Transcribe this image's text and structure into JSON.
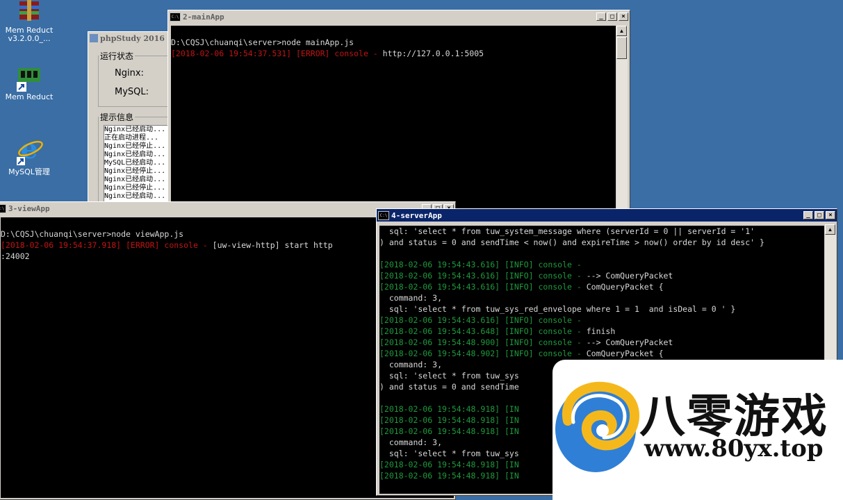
{
  "desktop": {
    "icons": [
      {
        "label": "Mem Reduct\nv3.2.0.0_...",
        "icon": "winrar-archive-icon"
      },
      {
        "label": "Mem Reduct",
        "icon": "memory-chip-icon"
      },
      {
        "label": "MySQL管理",
        "icon": "internet-explorer-icon"
      }
    ]
  },
  "phpstudy": {
    "title": "phpStudy 2016",
    "status_group": "运行状态",
    "nginx_label": "Nginx:",
    "mysql_label": "MySQL:",
    "hint_group": "提示信息",
    "hints": [
      "Nginx已经启动...",
      "正在启动进程...",
      "Nginx已经停止...",
      "Nginx已经启动...",
      "MySQL已经启动...",
      "Nginx已经停止...",
      "Nginx已经启动...",
      "Nginx已经停止...",
      "Nginx已经启动..."
    ]
  },
  "main_app": {
    "title": "2-mainApp",
    "lines": [
      [],
      [
        {
          "t": "D:\\CQSJ\\chuanqi\\server>node mainApp.js",
          "c": "white"
        }
      ],
      [
        {
          "t": "[2018-02-06 19:54:37.531] [ERROR] console - ",
          "c": "err"
        },
        {
          "t": "http://127.0.0.1:5005",
          "c": "white"
        }
      ]
    ]
  },
  "view_app": {
    "title": "3-viewApp",
    "lines": [
      [],
      [
        {
          "t": "D:\\CQSJ\\chuanqi\\server>node viewApp.js",
          "c": "white"
        }
      ],
      [
        {
          "t": "[2018-02-06 19:54:37.918] [ERROR] console - ",
          "c": "err"
        },
        {
          "t": "[uw-view-http] start http",
          "c": "white"
        }
      ],
      [
        {
          "t": ":24002",
          "c": "white"
        }
      ]
    ]
  },
  "server_app": {
    "title": "4-serverApp",
    "lines": [
      [
        {
          "t": "  sql: 'select * from tuw_system_message where (serverId = 0 || serverId = '1'",
          "c": "white"
        }
      ],
      [
        {
          "t": ") and status = 0 and sendTime < now() and expireTime > now() order by id desc' }",
          "c": "white"
        }
      ],
      [],
      [
        {
          "t": "[2018-02-06 19:54:43.616] [INFO] console - ",
          "c": "info"
        }
      ],
      [
        {
          "t": "[2018-02-06 19:54:43.616] [INFO] console - ",
          "c": "info"
        },
        {
          "t": "--> ComQueryPacket",
          "c": "white"
        }
      ],
      [
        {
          "t": "[2018-02-06 19:54:43.616] [INFO] console - ",
          "c": "info"
        },
        {
          "t": "ComQueryPacket {",
          "c": "white"
        }
      ],
      [
        {
          "t": "  command: 3,",
          "c": "white"
        }
      ],
      [
        {
          "t": "  sql: 'select * from tuw_sys_red_envelope where 1 = 1  and isDeal = 0 ' }",
          "c": "white"
        }
      ],
      [
        {
          "t": "[2018-02-06 19:54:43.616] [INFO] console - ",
          "c": "info"
        }
      ],
      [
        {
          "t": "[2018-02-06 19:54:43.648] [INFO] console - ",
          "c": "info"
        },
        {
          "t": "finish",
          "c": "white"
        }
      ],
      [
        {
          "t": "[2018-02-06 19:54:48.900] [INFO] console - ",
          "c": "info"
        },
        {
          "t": "--> ComQueryPacket",
          "c": "white"
        }
      ],
      [
        {
          "t": "[2018-02-06 19:54:48.902] [INFO] console - ",
          "c": "info"
        },
        {
          "t": "ComQueryPacket {",
          "c": "white"
        }
      ],
      [
        {
          "t": "  command: 3,",
          "c": "white"
        }
      ],
      [
        {
          "t": "  sql: 'select * from tuw_sys",
          "c": "white"
        }
      ],
      [
        {
          "t": ") and status = 0 and sendTime",
          "c": "white"
        }
      ],
      [],
      [
        {
          "t": "[2018-02-06 19:54:48.918] [IN",
          "c": "info"
        }
      ],
      [
        {
          "t": "[2018-02-06 19:54:48.918] [IN",
          "c": "info"
        }
      ],
      [
        {
          "t": "[2018-02-06 19:54:48.918] [IN",
          "c": "info"
        }
      ],
      [
        {
          "t": "  command: 3,",
          "c": "white"
        }
      ],
      [
        {
          "t": "  sql: 'select * from tuw_sys",
          "c": "white"
        }
      ],
      [
        {
          "t": "[2018-02-06 19:54:48.918] [IN",
          "c": "info"
        }
      ],
      [
        {
          "t": "[2018-02-06 19:54:48.918] [IN",
          "c": "info"
        }
      ]
    ]
  },
  "watermark": {
    "name": "八零游戏",
    "url": "www.80yx.top"
  },
  "colors": {
    "desktop": "#3a6ea5",
    "error_text": "#c01414",
    "info_text": "#1e9a3c",
    "active_title": "#0a246a"
  }
}
